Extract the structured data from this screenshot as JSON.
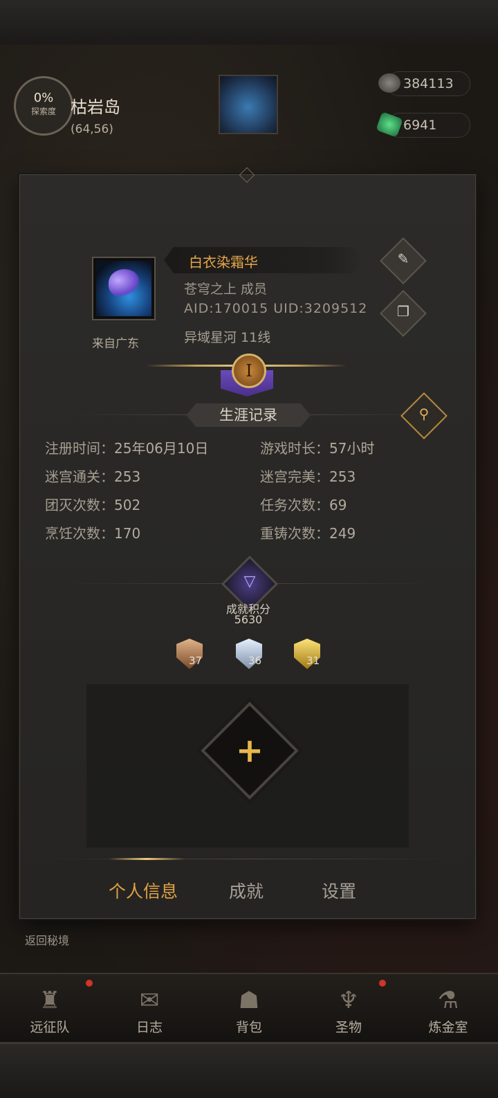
{
  "hud": {
    "explore_percent": "0%",
    "explore_label": "探索度",
    "location_name": "枯岩岛",
    "location_coords": "(64,56)",
    "stone_count": "384113",
    "gem_count": "6941",
    "return_label": "返回秘境"
  },
  "profile": {
    "from": "来自广东",
    "name": "白衣染霜华",
    "guild": "苍穹之上  成员",
    "ids": "AID:170015 UID:3209512",
    "server": "异域星河  11线",
    "rank_numeral": "I"
  },
  "career": {
    "title": "生涯记录",
    "stats": [
      {
        "label": "注册时间：",
        "value": "25年06月10日"
      },
      {
        "label": "游戏时长：",
        "value": "57小时"
      },
      {
        "label": "迷宫通关：",
        "value": "253"
      },
      {
        "label": "迷宫完美：",
        "value": "253"
      },
      {
        "label": "团灭次数：",
        "value": "502"
      },
      {
        "label": "任务次数：",
        "value": "69"
      },
      {
        "label": "烹饪次数：",
        "value": "170"
      },
      {
        "label": "重铸次数：",
        "value": "249"
      }
    ]
  },
  "achievement": {
    "label": "成就积分",
    "score": "5630",
    "medals": [
      {
        "tier": "bronze",
        "count": "37"
      },
      {
        "tier": "silver",
        "count": "36"
      },
      {
        "tier": "gold",
        "count": "31"
      }
    ]
  },
  "tabs": [
    {
      "label": "个人信息",
      "active": true
    },
    {
      "label": "成就",
      "active": false
    },
    {
      "label": "设置",
      "active": false
    }
  ],
  "nav": [
    {
      "label": "远征队",
      "icon": "helmet-icon"
    },
    {
      "label": "日志",
      "icon": "scroll-icon"
    },
    {
      "label": "背包",
      "icon": "bag-icon"
    },
    {
      "label": "圣物",
      "icon": "relic-icon"
    },
    {
      "label": "炼金室",
      "icon": "alchemy-icon"
    }
  ],
  "colors": {
    "accent_orange": "#e0a244",
    "gold": "#e8b74a",
    "panel_bg": "#2c2b29"
  }
}
